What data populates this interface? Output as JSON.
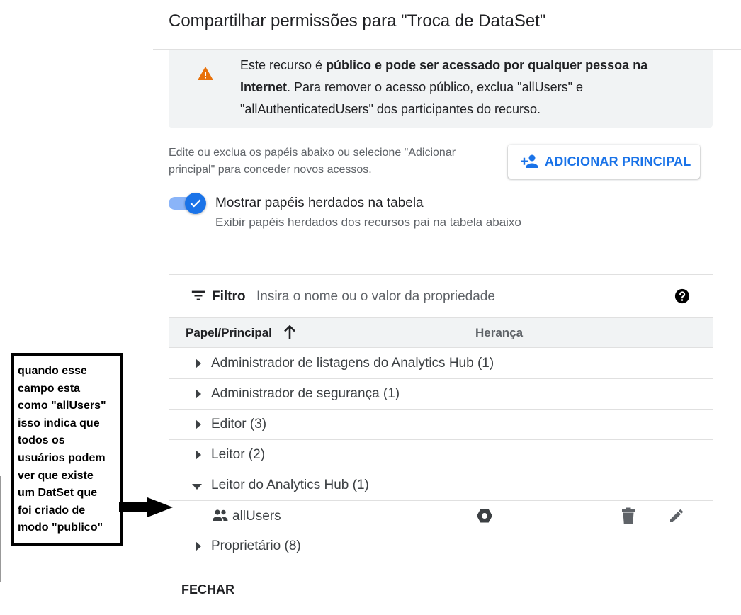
{
  "dialog": {
    "title": "Compartilhar permissões para \"Troca de DataSet\""
  },
  "warning": {
    "icon": "warning-icon",
    "color": "#e8710a",
    "text_prefix": "Este recurso é ",
    "text_bold": "público e pode ser acessado por qualquer pessoa na Internet",
    "text_suffix": ". Para remover o acesso público, exclua \"allUsers\" e \"allAuthenticatedUsers\" dos participantes do recurso."
  },
  "description": "Edite ou exclua os papéis abaixo ou selecione \"Adicionar principal\" para conceder novos acessos.",
  "add_principal": {
    "label": "ADICIONAR PRINCIPAL",
    "icon": "person-add-icon",
    "color": "#1a73e8"
  },
  "inherited_toggle": {
    "checked": true,
    "label": "Mostrar papéis herdados na tabela",
    "sublabel": "Exibir papéis herdados dos recursos pai na tabela abaixo"
  },
  "filter": {
    "label": "Filtro",
    "placeholder": "Insira o nome ou o valor da propriedade",
    "value": ""
  },
  "table": {
    "columns": {
      "role": "Papel/Principal",
      "inheritance": "Herança"
    },
    "sort": "ascending",
    "roles": [
      {
        "label": "Administrador de listagens do Analytics Hub (1)",
        "expanded": false
      },
      {
        "label": "Administrador de segurança (1)",
        "expanded": false
      },
      {
        "label": "Editor (3)",
        "expanded": false
      },
      {
        "label": "Leitor (2)",
        "expanded": false
      },
      {
        "label": "Leitor do Analytics Hub (1)",
        "expanded": true
      },
      {
        "label": "Proprietário (8)",
        "expanded": false
      }
    ],
    "expanded_member": {
      "name": "allUsers",
      "icon": "people-icon",
      "inheritance_icon": "hexagon-icon"
    }
  },
  "footer": {
    "close_label": "FECHAR"
  },
  "annotation": {
    "lines": [
      "quando esse",
      "campo esta",
      "como \"allUsers\"",
      "isso indica que",
      "todos os",
      "usuários podem",
      "ver que existe",
      "um DatSet que",
      "foi criado de",
      "modo \"publico\""
    ]
  }
}
